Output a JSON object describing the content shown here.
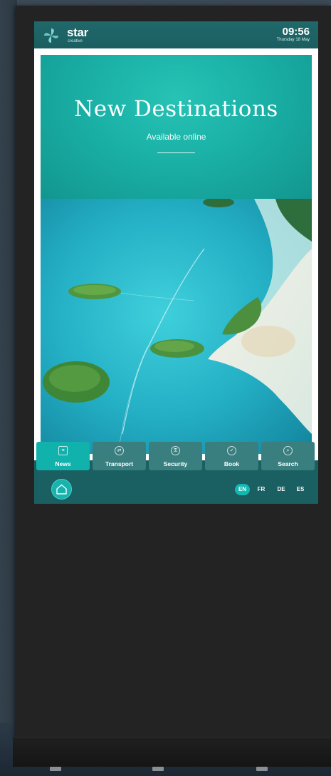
{
  "header": {
    "brand": "star",
    "brand_sub": "creative",
    "time": "09:56",
    "date": "Thursday 18 May"
  },
  "poster": {
    "headline": "New Destinations",
    "subline": "Available online"
  },
  "tabs": [
    {
      "label": "News",
      "icon": "news-icon",
      "active": true
    },
    {
      "label": "Transport",
      "icon": "transport-icon",
      "active": false
    },
    {
      "label": "Security",
      "icon": "security-icon",
      "active": false
    },
    {
      "label": "Book",
      "icon": "book-check-icon",
      "active": false
    },
    {
      "label": "Search",
      "icon": "search-icon",
      "active": false
    }
  ],
  "languages": {
    "items": [
      "EN",
      "FR",
      "DE",
      "ES"
    ],
    "selected": "EN"
  },
  "colors": {
    "accent": "#12b2ac",
    "bar": "#1a5f61",
    "tab": "#3a7f80",
    "poster_teal": "#1ab0a6"
  }
}
